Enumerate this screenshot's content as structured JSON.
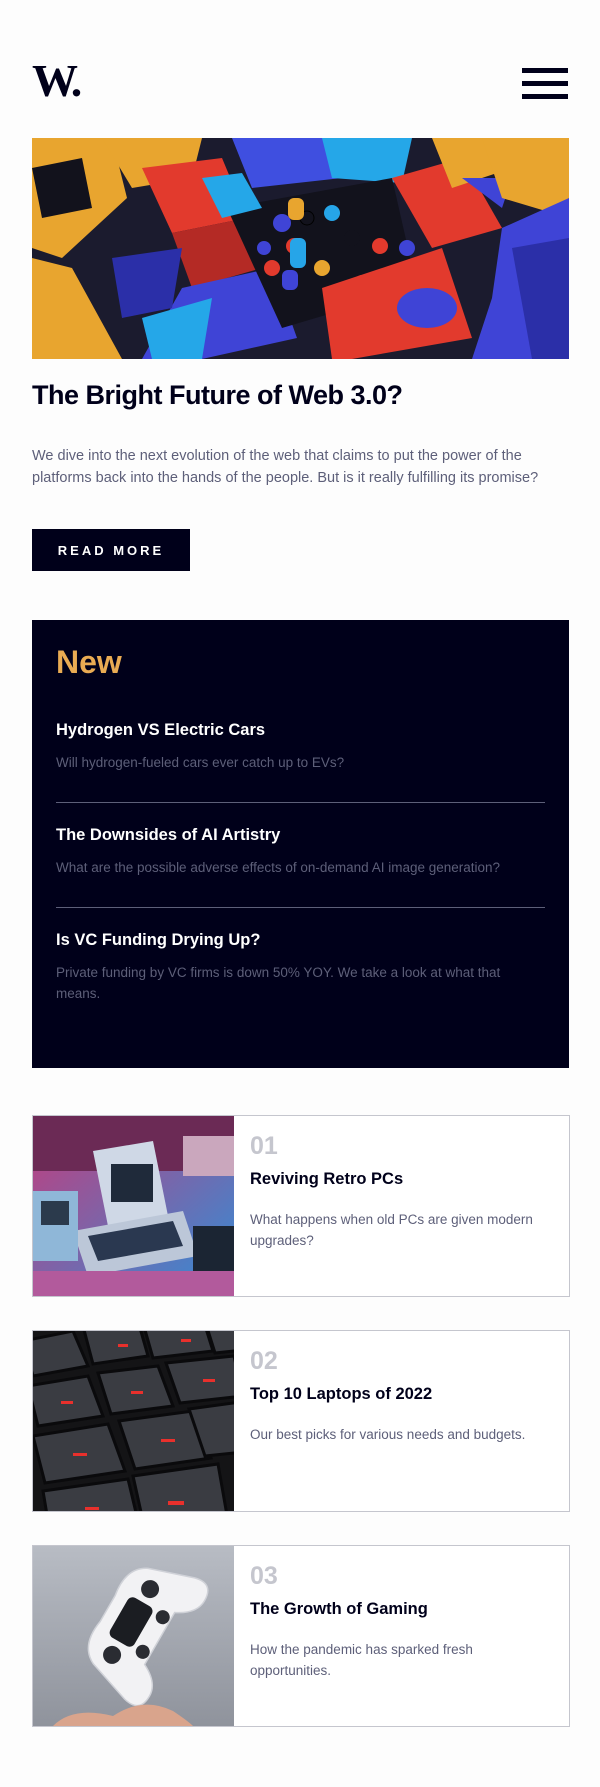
{
  "header": {
    "logo_text": "W.",
    "menu_icon": "hamburger-icon"
  },
  "hero": {
    "title": "The Bright Future of Web 3.0?",
    "description": "We dive into the next evolution of the web that claims to put the power of the platforms back into the hands of the people. But is it really fulfilling its promise?",
    "button_label": "READ MORE"
  },
  "new_section": {
    "heading": "New",
    "items": [
      {
        "title": "Hydrogen VS Electric Cars",
        "description": "Will hydrogen-fueled cars ever catch up to EVs?"
      },
      {
        "title": "The Downsides of AI Artistry",
        "description": "What are the possible adverse effects of on-demand AI image generation?"
      },
      {
        "title": "Is VC Funding Drying Up?",
        "description": "Private funding by VC firms is down 50% YOY. We take a look at what that means."
      }
    ]
  },
  "articles": [
    {
      "number": "01",
      "title": "Reviving Retro PCs",
      "description": "What happens when old PCs are given modern upgrades?"
    },
    {
      "number": "02",
      "title": "Top 10 Laptops of 2022",
      "description": "Our best picks for various needs and budgets."
    },
    {
      "number": "03",
      "title": "The Growth of Gaming",
      "description": "How the pandemic has sparked fresh opportunities."
    }
  ],
  "colors": {
    "dark_navy": "#00001a",
    "accent_orange": "#e9ab53",
    "grayish_blue": "#5d5f79",
    "light_gray": "#c5c6ce",
    "off_white": "#fdfdfd"
  }
}
